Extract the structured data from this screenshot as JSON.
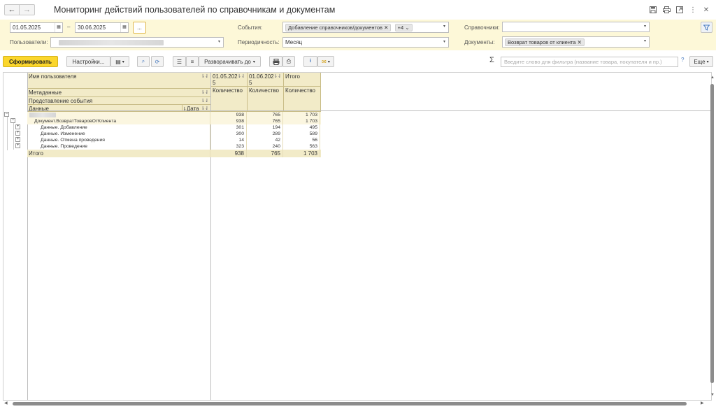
{
  "window": {
    "title": "Мониторинг действий пользователей по справочникам и документам"
  },
  "icons": {
    "back": "arrow-left-icon",
    "forward": "arrow-right-icon",
    "save": "save-icon",
    "print": "print-icon",
    "link": "link-icon",
    "more": "more-vertical-icon",
    "close": "close-icon"
  },
  "filters": {
    "date_from": "01.05.2025",
    "dash": "–",
    "date_to": "30.06.2025",
    "period_btn": "...",
    "users_label": "Пользователи:",
    "events_label": "События:",
    "events_tag": "Добавление справочников/документов",
    "events_more": "+4",
    "periodicity_label": "Периодичность:",
    "periodicity_value": "Месяц",
    "catalogs_label": "Справочники:",
    "documents_label": "Документы:",
    "documents_tag": "Возврат товаров от клиента"
  },
  "toolbar": {
    "generate": "Сформировать",
    "settings": "Настройки...",
    "expand_to": "Разворачивать до",
    "sigma": "Σ",
    "search_placeholder": "Введите слово для фильтра (название товара, покупателя и пр.)",
    "help": "?",
    "more": "Еще"
  },
  "report": {
    "headers": {
      "user_name": "Имя пользователя",
      "metadata": "Метаданные",
      "event_repr": "Представление события",
      "data": "Данные",
      "date": "Дата",
      "period1_line1": "01.05.202",
      "period1_line2": "5",
      "period2_line1": "01.06.202",
      "period2_line2": "5",
      "total_col": "Итого",
      "qty": "Количество"
    },
    "rows": [
      {
        "label": "",
        "v1": "938",
        "v2": "765",
        "total": "1 703"
      },
      {
        "label": "Документ.ВозвратТоваровОтКлиента",
        "v1": "938",
        "v2": "765",
        "total": "1 703"
      },
      {
        "label": "Данные. Добавление",
        "v1": "301",
        "v2": "194",
        "total": "495"
      },
      {
        "label": "Данные. Изменение",
        "v1": "300",
        "v2": "289",
        "total": "589"
      },
      {
        "label": "Данные. Отмена проведения",
        "v1": "14",
        "v2": "42",
        "total": "56"
      },
      {
        "label": "Данные. Проведение",
        "v1": "323",
        "v2": "240",
        "total": "563"
      }
    ],
    "total": {
      "label": "Итого",
      "v1": "938",
      "v2": "765",
      "total": "1 703"
    }
  }
}
